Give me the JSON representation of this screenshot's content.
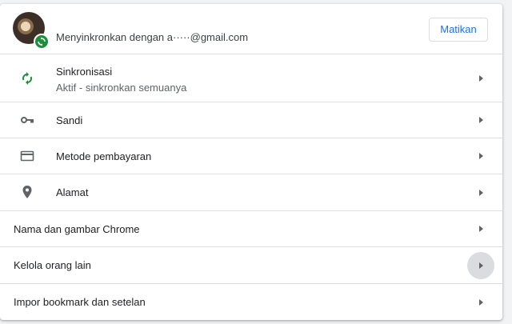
{
  "account": {
    "name": "",
    "email_text": "Menyinkronkan dengan a·····@gmail.com",
    "button_label": "Matikan"
  },
  "rows": [
    {
      "label": "Sinkronisasi",
      "sublabel": "Aktif - sinkronkan semuanya",
      "icon": "sync-icon"
    },
    {
      "label": "Sandi",
      "icon": "key-icon"
    },
    {
      "label": "Metode pembayaran",
      "icon": "credit-card-icon"
    },
    {
      "label": "Alamat",
      "icon": "location-pin-icon"
    },
    {
      "label": "Nama dan gambar Chrome"
    },
    {
      "label": "Kelola orang lain"
    },
    {
      "label": "Impor bookmark dan setelan"
    }
  ],
  "colors": {
    "accent": "#1a73e8",
    "sync_green": "#1e8e3e",
    "icon_gray": "#5f6368"
  }
}
